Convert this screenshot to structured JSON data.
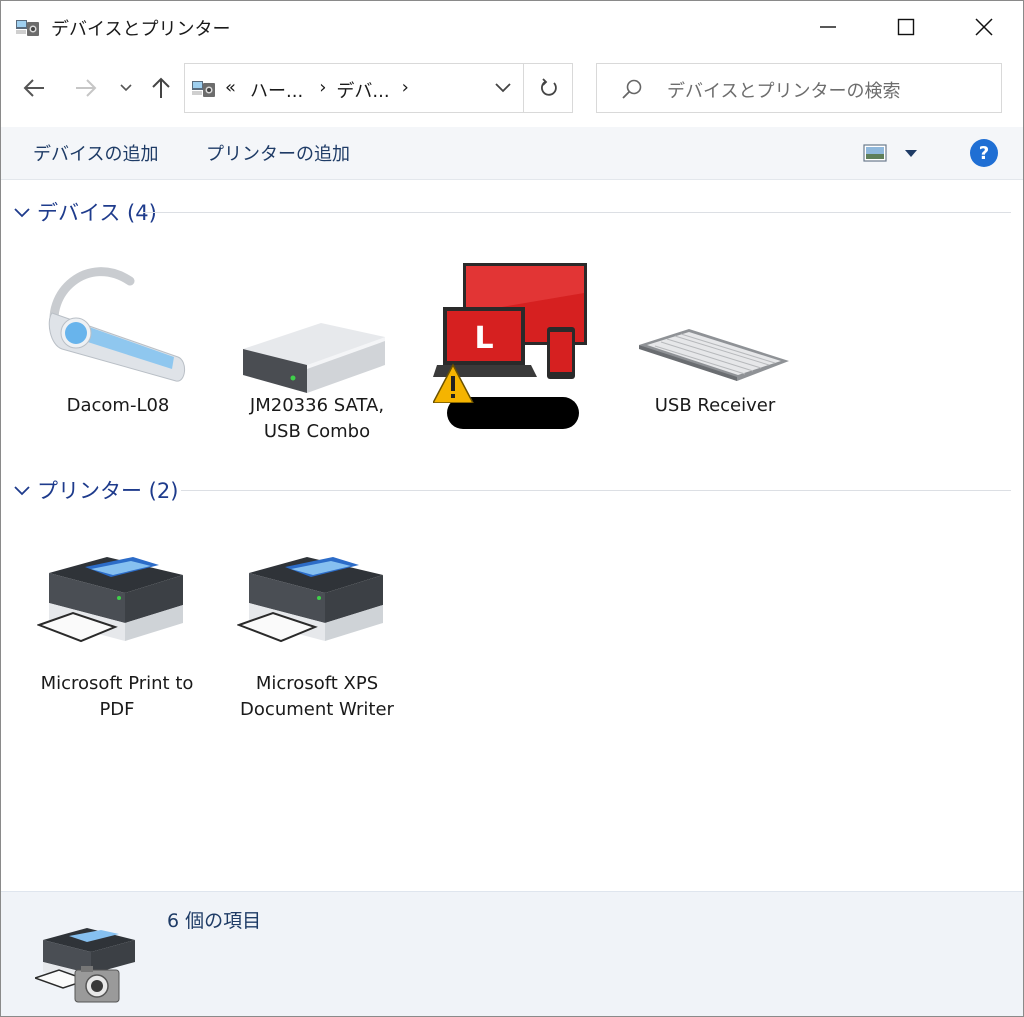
{
  "window": {
    "title": "デバイスとプリンター"
  },
  "address": {
    "prefix": "«",
    "crumbs": [
      "ハー...",
      "デバ..."
    ],
    "separator": "›"
  },
  "search": {
    "placeholder": "デバイスとプリンターの検索"
  },
  "toolbar": {
    "add_device": "デバイスの追加",
    "add_printer": "プリンターの追加"
  },
  "groups": [
    {
      "title": "デバイス (4)",
      "items": [
        {
          "label": "Dacom-L08",
          "icon": "headset-icon"
        },
        {
          "label": "JM20336 SATA, USB Combo",
          "icon": "drive-icon"
        },
        {
          "label": "",
          "icon": "computer-warning-icon",
          "redacted": true
        },
        {
          "label": "USB Receiver",
          "icon": "keyboard-icon"
        }
      ]
    },
    {
      "title": "プリンター (2)",
      "items": [
        {
          "label": "Microsoft Print to PDF",
          "icon": "printer-icon"
        },
        {
          "label": "Microsoft XPS Document Writer",
          "icon": "printer-icon"
        }
      ]
    }
  ],
  "status": {
    "text": "6 個の項目"
  },
  "colors": {
    "accent": "#1e3b8c",
    "help": "#1f6fd4",
    "device_red": "#d62020",
    "warning": "#f5b400"
  }
}
